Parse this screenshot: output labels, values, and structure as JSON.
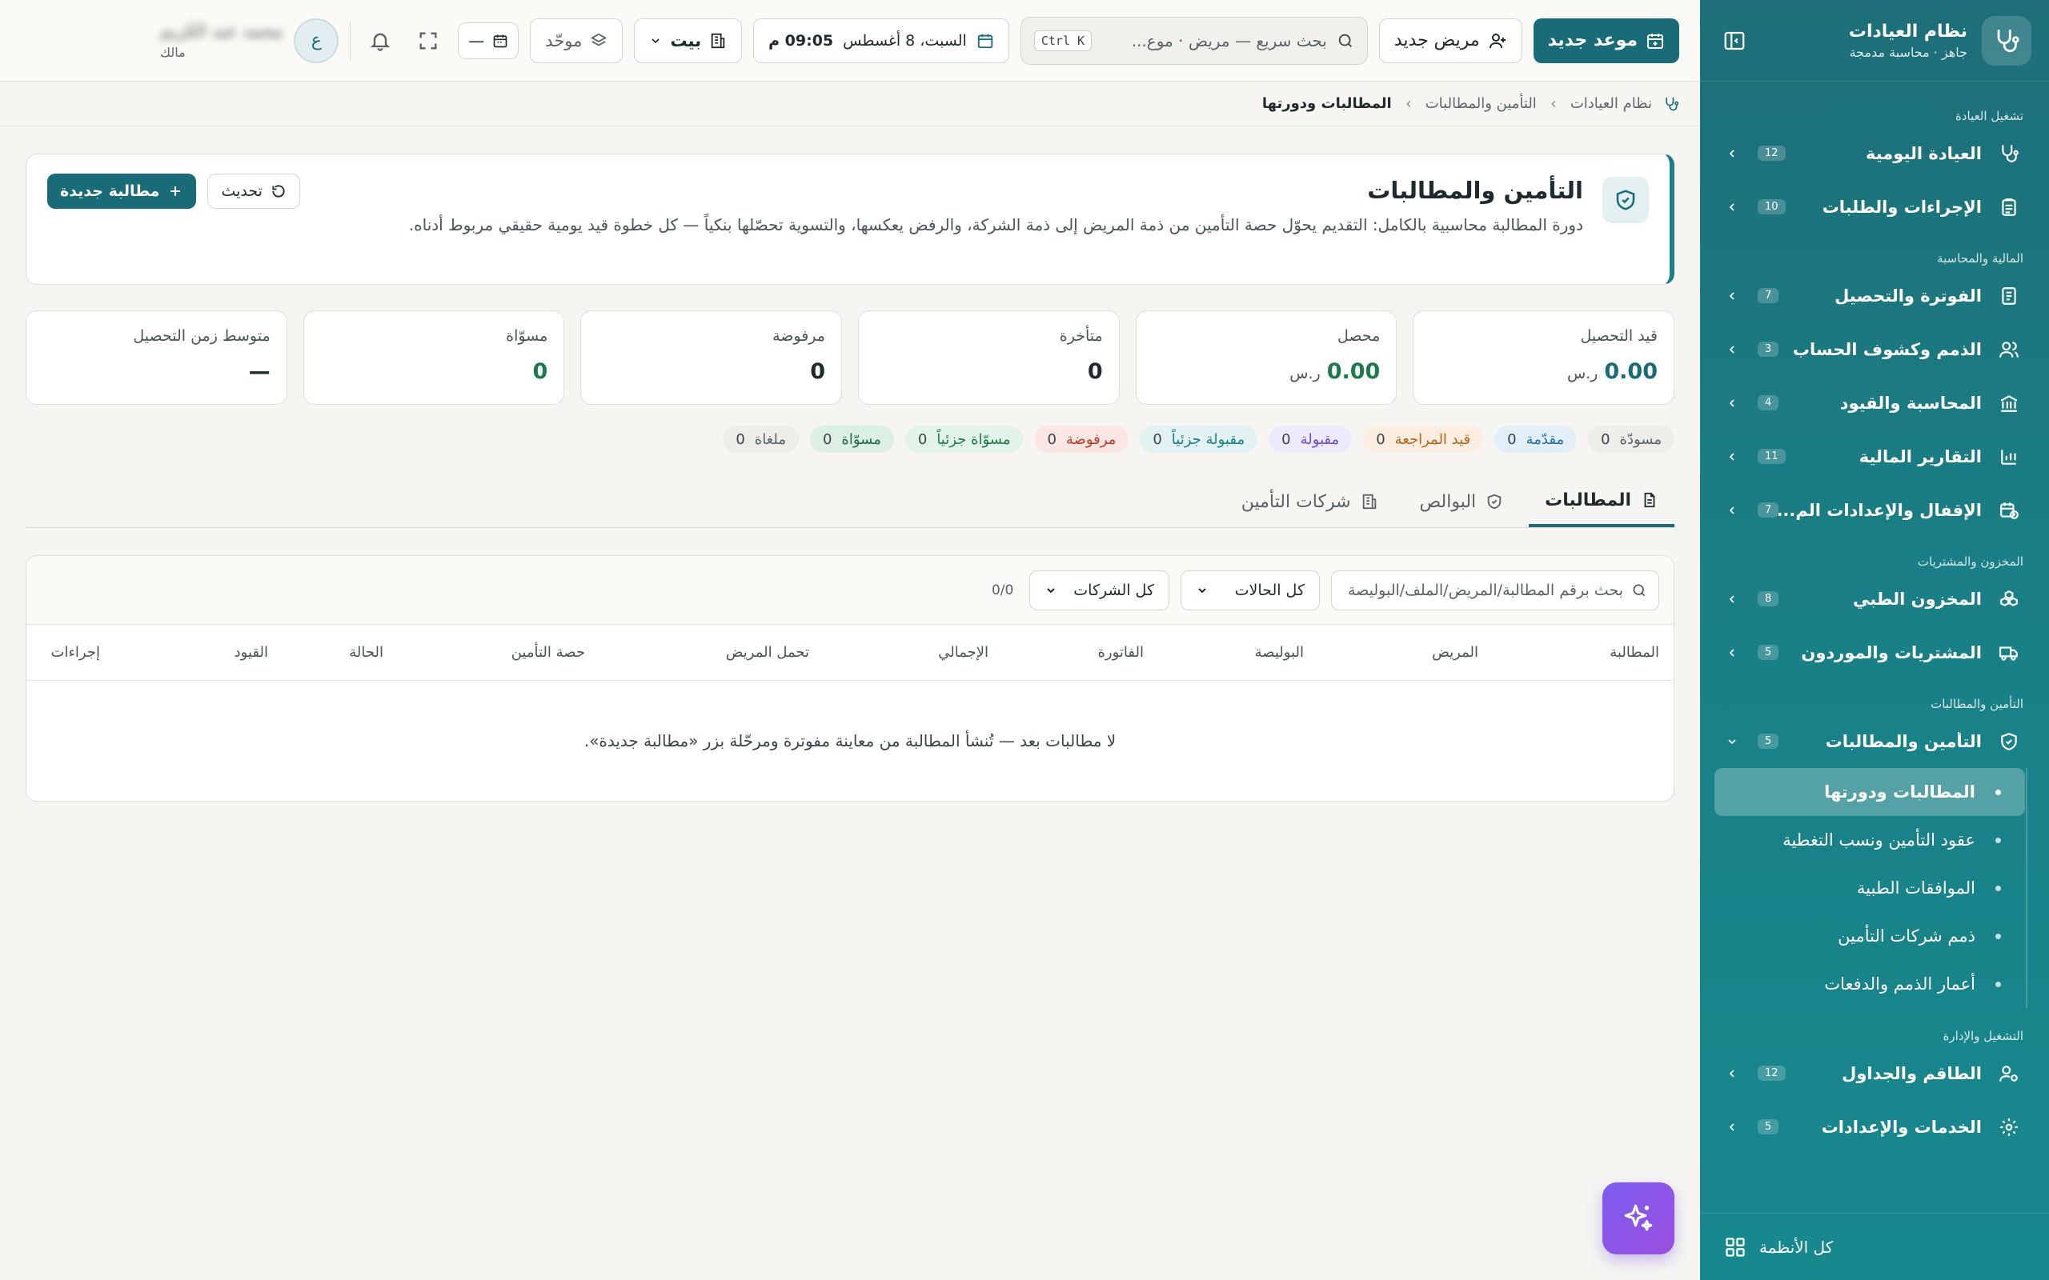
{
  "app": {
    "name": "نظام العيادات",
    "status": "جاهز · محاسبة مدمجة"
  },
  "sidebar": {
    "sections": [
      {
        "title": "تشغيل العيادة",
        "items": [
          {
            "label": "العيادة اليومية",
            "count": "12"
          },
          {
            "label": "الإجراءات والطلبات",
            "count": "10"
          }
        ]
      },
      {
        "title": "المالية والمحاسبة",
        "items": [
          {
            "label": "الفوترة والتحصيل",
            "count": "7"
          },
          {
            "label": "الذمم وكشوف الحساب",
            "count": "3"
          },
          {
            "label": "المحاسبة والقيود",
            "count": "4"
          },
          {
            "label": "التقارير المالية",
            "count": "11"
          },
          {
            "label": "الإقفال والإعدادات الم...",
            "count": "7"
          }
        ]
      },
      {
        "title": "المخزون والمشتريات",
        "items": [
          {
            "label": "المخزون الطبي",
            "count": "8"
          },
          {
            "label": "المشتريات والموردون",
            "count": "5"
          }
        ]
      },
      {
        "title": "التأمين والمطالبات",
        "items": [
          {
            "label": "التأمين والمطالبات",
            "count": "5"
          }
        ]
      },
      {
        "title": "التشغيل والإدارة",
        "items": [
          {
            "label": "الطاقم والجداول",
            "count": "12"
          },
          {
            "label": "الخدمات والإعدادات",
            "count": "5"
          }
        ]
      }
    ],
    "subitems": [
      "المطالبات ودورتها",
      "عقود التأمين ونسب التغطية",
      "الموافقات الطبية",
      "ذمم شركات التأمين",
      "أعمار الذمم والدفعات"
    ],
    "footer": "كل الأنظمة"
  },
  "topbar": {
    "new_appointment": "موعد جديد",
    "new_patient": "مريض جديد",
    "search_placeholder": "بحث سريع — مريض · موع...",
    "shortcut": "Ctrl K",
    "date": "السبت، 8 أغسطس",
    "time": "09:05 م",
    "branch": "بيت",
    "view": "موحّد",
    "calendar_value": "—",
    "avatar_letter": "ع",
    "user_name": "محمد عبد الكريم",
    "user_role": "مالك"
  },
  "breadcrumb": [
    "نظام العيادات",
    "التأمين والمطالبات",
    "المطالبات ودورتها"
  ],
  "hero": {
    "title": "التأمين والمطالبات",
    "description": "دورة المطالبة محاسبية بالكامل: التقديم يحوّل حصة التأمين من ذمة المريض إلى ذمة الشركة، والرفض يعكسها، والتسوية تحصّلها بنكياً — كل خطوة قيد يومية حقيقي مربوط أدناه.",
    "refresh": "تحديث",
    "new_claim": "مطالبة جديدة"
  },
  "stats": [
    {
      "label": "قيد التحصيل",
      "value": "0.00",
      "currency": "ر.س"
    },
    {
      "label": "محصل",
      "value": "0.00",
      "currency": "ر.س"
    },
    {
      "label": "متأخرة",
      "value": "0"
    },
    {
      "label": "مرفوضة",
      "value": "0"
    },
    {
      "label": "مسوّاة",
      "value": "0"
    },
    {
      "label": "متوسط زمن التحصيل",
      "value": "—"
    }
  ],
  "status_chips": [
    {
      "label": "مسودّة",
      "count": "0",
      "color": "#5a6264",
      "bg": "#efedea"
    },
    {
      "label": "مقدّمة",
      "count": "0",
      "color": "#1f6fa8",
      "bg": "#e3eff8"
    },
    {
      "label": "قيد المراجعة",
      "count": "0",
      "color": "#b5651d",
      "bg": "#fbeee1"
    },
    {
      "label": "مقبولة",
      "count": "0",
      "color": "#6a4fd0",
      "bg": "#eeeafc"
    },
    {
      "label": "مقبولة جزئياً",
      "count": "0",
      "color": "#1a7f86",
      "bg": "#e2f2f2"
    },
    {
      "label": "مرفوضة",
      "count": "0",
      "color": "#c0392b",
      "bg": "#fbe6e3"
    },
    {
      "label": "مسوّاة جزئياً",
      "count": "0",
      "color": "#1e7a4c",
      "bg": "#e2f3ea"
    },
    {
      "label": "مسوّاة",
      "count": "0",
      "color": "#1e6b45",
      "bg": "#dcefe3"
    },
    {
      "label": "ملغاة",
      "count": "0",
      "color": "#5a6264",
      "bg": "#efedea"
    }
  ],
  "tabs": [
    "المطالبات",
    "البوالص",
    "شركات التأمين"
  ],
  "table": {
    "search_placeholder": "بحث برقم المطالبة/المريض/الملف/البوليصة",
    "status_filter": "كل الحالات",
    "company_filter": "كل الشركات",
    "counter": "0/0",
    "columns": [
      "المطالبة",
      "المريض",
      "البوليصة",
      "الفاتورة",
      "الإجمالي",
      "تحمل المريض",
      "حصة التأمين",
      "الحالة",
      "القيود",
      "إجراءات"
    ],
    "empty": "لا مطالبات بعد — تُنشأ المطالبة من معاينة مفوترة ومرحّلة بزر «مطالبة جديدة»."
  },
  "colors": {
    "primary": "#1a6b78",
    "sidebar": "#1a7f86",
    "fab": "#7c5cf0"
  }
}
